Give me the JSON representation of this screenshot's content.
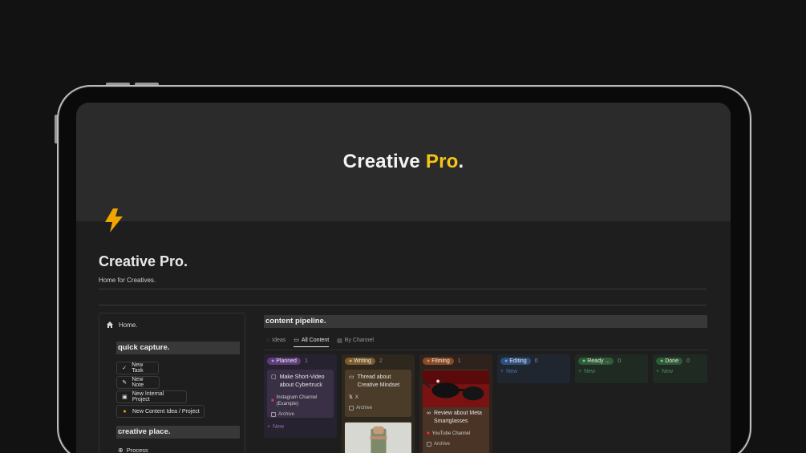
{
  "cover": {
    "title_main": "Creative",
    "title_accent": "Pro",
    "title_dot": "."
  },
  "page": {
    "title": "Creative Pro.",
    "subtitle": "Home for Creatives."
  },
  "sidebar": {
    "home_label": "Home.",
    "quick_capture": "quick capture.",
    "buttons": [
      {
        "label": "New Task",
        "icon": "check-icon"
      },
      {
        "label": "New Note",
        "icon": "pencil-icon"
      },
      {
        "label": "New Internal Project",
        "icon": "briefcase-icon"
      },
      {
        "label": "New Content Idea / Project",
        "icon": "lightbulb-icon"
      }
    ],
    "creative_place": "creative place.",
    "process_label": "Process"
  },
  "pipeline": {
    "title": "content pipeline.",
    "tabs": [
      {
        "label": "Ideas",
        "icon": "lightbulb-icon"
      },
      {
        "label": "All Content",
        "icon": "monitor-icon",
        "active": true
      },
      {
        "label": "By Channel",
        "icon": "ticket-icon"
      }
    ],
    "columns": [
      {
        "name": "Planned",
        "count": "1",
        "color": "#5c3d7a"
      },
      {
        "name": "Writing",
        "count": "2",
        "color": "#7a5c2e"
      },
      {
        "name": "Filming",
        "count": "1",
        "color": "#8a4a26"
      },
      {
        "name": "Editing",
        "count": "0",
        "color": "#2f4f7a"
      },
      {
        "name": "Ready ...",
        "count": "0",
        "color": "#2f5a36"
      },
      {
        "name": "Done",
        "count": "0",
        "color": "#2f5a36"
      }
    ],
    "cards": {
      "planned": {
        "title": "Make Short-Video about Cybertruck",
        "channel": "Instagram Channel (Example)",
        "archive": "Archive",
        "new": "New"
      },
      "writing": {
        "title": "Thread about Creative Mindset",
        "channel": "X",
        "archive": "Archive"
      },
      "filming": {
        "title": "Review about Meta Smartglasses",
        "channel": "YouTube Channel",
        "archive": "Archive"
      }
    },
    "new_label": "New"
  }
}
